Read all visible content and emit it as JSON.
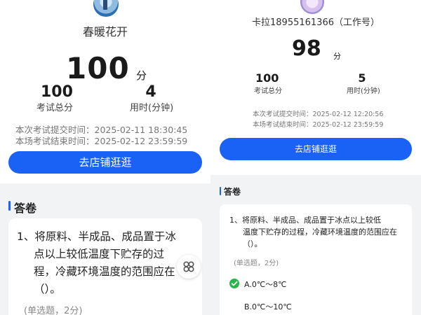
{
  "left": {
    "nickname": "春暖花开",
    "score": "100",
    "score_unit": "分",
    "total_value": "100",
    "total_label": "考试总分",
    "time_value": "4",
    "time_label": "用时(分钟)",
    "submit_time": "本次考试提交时间：2025-02-11 18:30:45",
    "end_time": "本场考试结束时间：2025-02-12 23:59:59",
    "shop_button": "去店铺逛逛",
    "section_title": "答卷",
    "question_line1": "1、将原料、半成品、成品置于冰",
    "question_line2": "点以上较低温度下贮存的过",
    "question_line3": "程，冷藏环境温度的范围应在",
    "question_line4": "（）。",
    "question_type": "(单选题，2分)"
  },
  "right": {
    "nickname": "卡拉18955161366（工作号）",
    "score": "98",
    "score_unit": "分",
    "total_value": "100",
    "total_label": "考试总分",
    "time_value": "5",
    "time_label": "用时(分钟)",
    "submit_time": "本次考试提交时间：2025-02-12 12:20:56",
    "end_time": "本场考试结束时间：2025-02-12 23:59:59",
    "shop_button": "去店铺逛逛",
    "section_title": "答卷",
    "question_line1": "1、将原料、半成品、成品置于冰点以上较低",
    "question_line2": "温度下贮存的过程，冷藏环境温度的范围应在",
    "question_line3": "（）。",
    "question_type": "(单选题，2分)",
    "option_a": "A.0℃～8℃",
    "option_b": "B.0℃～10℃"
  },
  "colors": {
    "accent": "#1a62f5",
    "correct": "#2bb44a",
    "band": "#f2f3f5"
  },
  "icons": {
    "fab": "clover-icon",
    "correct": "check-circle-icon"
  }
}
